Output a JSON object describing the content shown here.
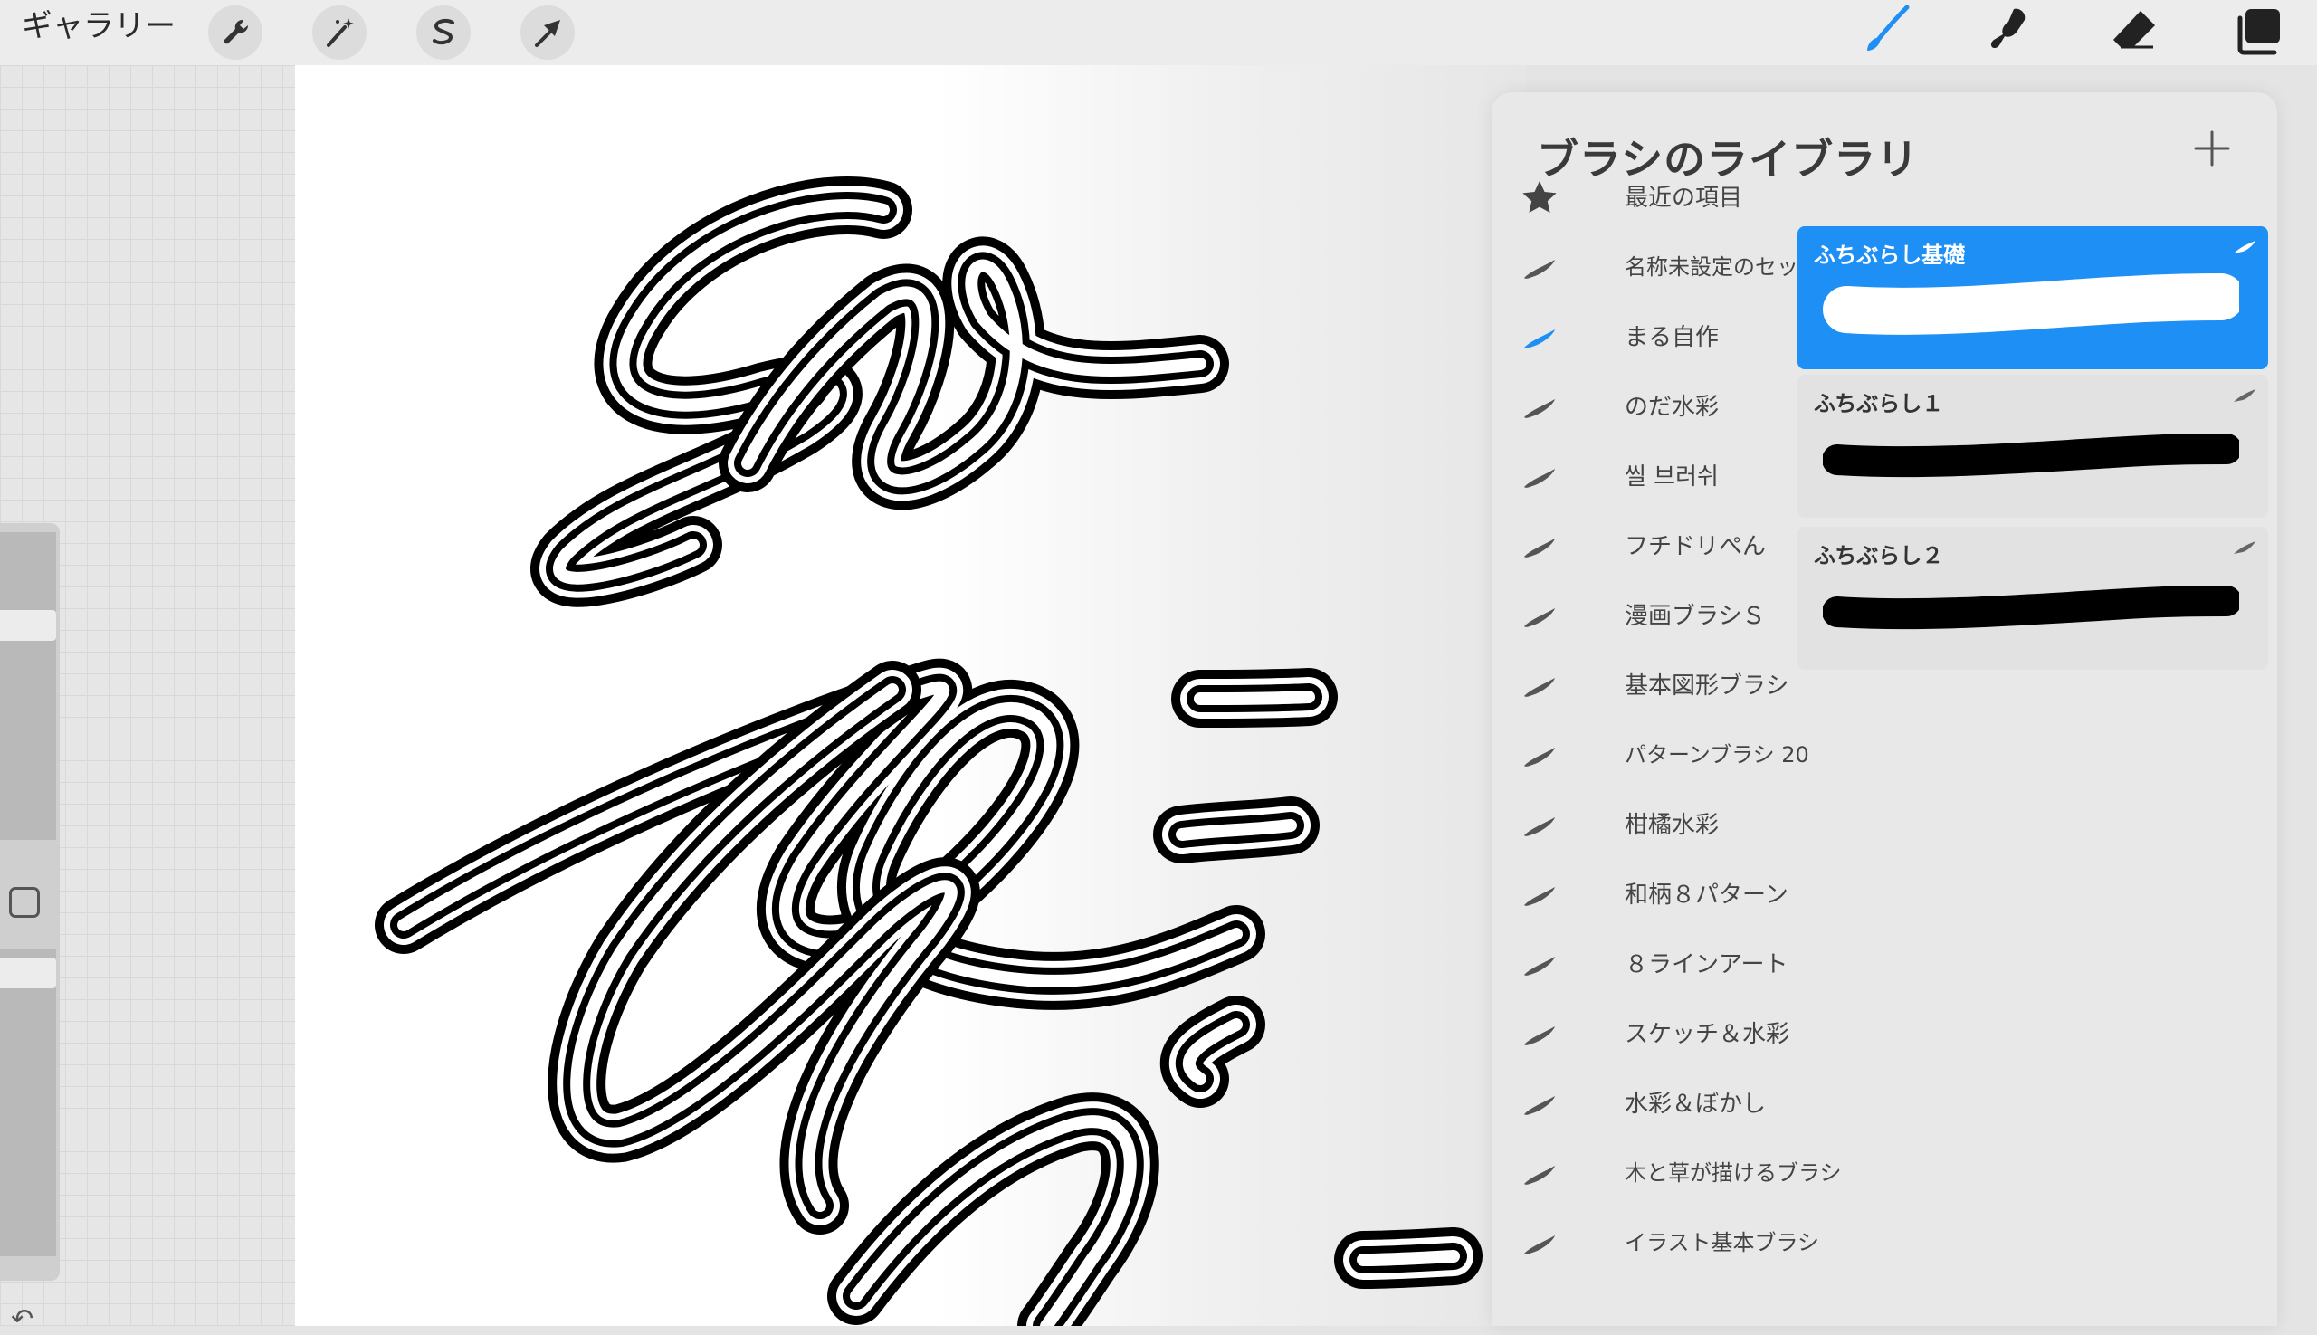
{
  "topbar": {
    "gallery_label": "ギャラリー",
    "left_tools": [
      "wrench-icon",
      "magic-wand-icon",
      "selection-s-icon",
      "arrow-icon"
    ],
    "right_tools": [
      "brush-icon",
      "smudge-icon",
      "eraser-icon",
      "layers-icon"
    ],
    "active_color": "#1e8ff5"
  },
  "panel": {
    "title": "ブラシのライブラリ",
    "add_icon": "plus-icon",
    "sets": [
      {
        "label": "最近の項目",
        "icon": "star-icon"
      },
      {
        "label": "名称未設定のセット",
        "icon": "brush-stroke-icon"
      },
      {
        "label": "まる自作",
        "icon": "brush-stroke-icon",
        "active": true
      },
      {
        "label": "のだ水彩",
        "icon": "brush-stroke-icon"
      },
      {
        "label": "씰 브러쉬",
        "icon": "brush-stroke-icon"
      },
      {
        "label": "フチドリぺん",
        "icon": "brush-stroke-icon"
      },
      {
        "label": "漫画ブラシＳ",
        "icon": "brush-stroke-icon"
      },
      {
        "label": "基本図形ブラシ",
        "icon": "brush-stroke-icon"
      },
      {
        "label": "パターンブラシ 20",
        "icon": "brush-stroke-icon"
      },
      {
        "label": "柑橘水彩",
        "icon": "brush-stroke-icon"
      },
      {
        "label": "和柄８パターン",
        "icon": "brush-stroke-icon"
      },
      {
        "label": "８ラインアート",
        "icon": "brush-stroke-icon"
      },
      {
        "label": "スケッチ＆水彩",
        "icon": "brush-stroke-icon"
      },
      {
        "label": "水彩＆ぼかし",
        "icon": "brush-stroke-icon"
      },
      {
        "label": "木と草が描けるブラシ",
        "icon": "brush-stroke-icon"
      },
      {
        "label": "イラスト基本ブラシ",
        "icon": "brush-stroke-icon"
      }
    ],
    "brushes": [
      {
        "name": "ふちぶらし基礎",
        "selected": true
      },
      {
        "name": "ふちぶらし１",
        "selected": false
      },
      {
        "name": "ふちぶらし２",
        "selected": false
      }
    ]
  },
  "sidebar": {
    "undo_icon": "undo-icon",
    "modify_icon": "square-modify-icon"
  }
}
